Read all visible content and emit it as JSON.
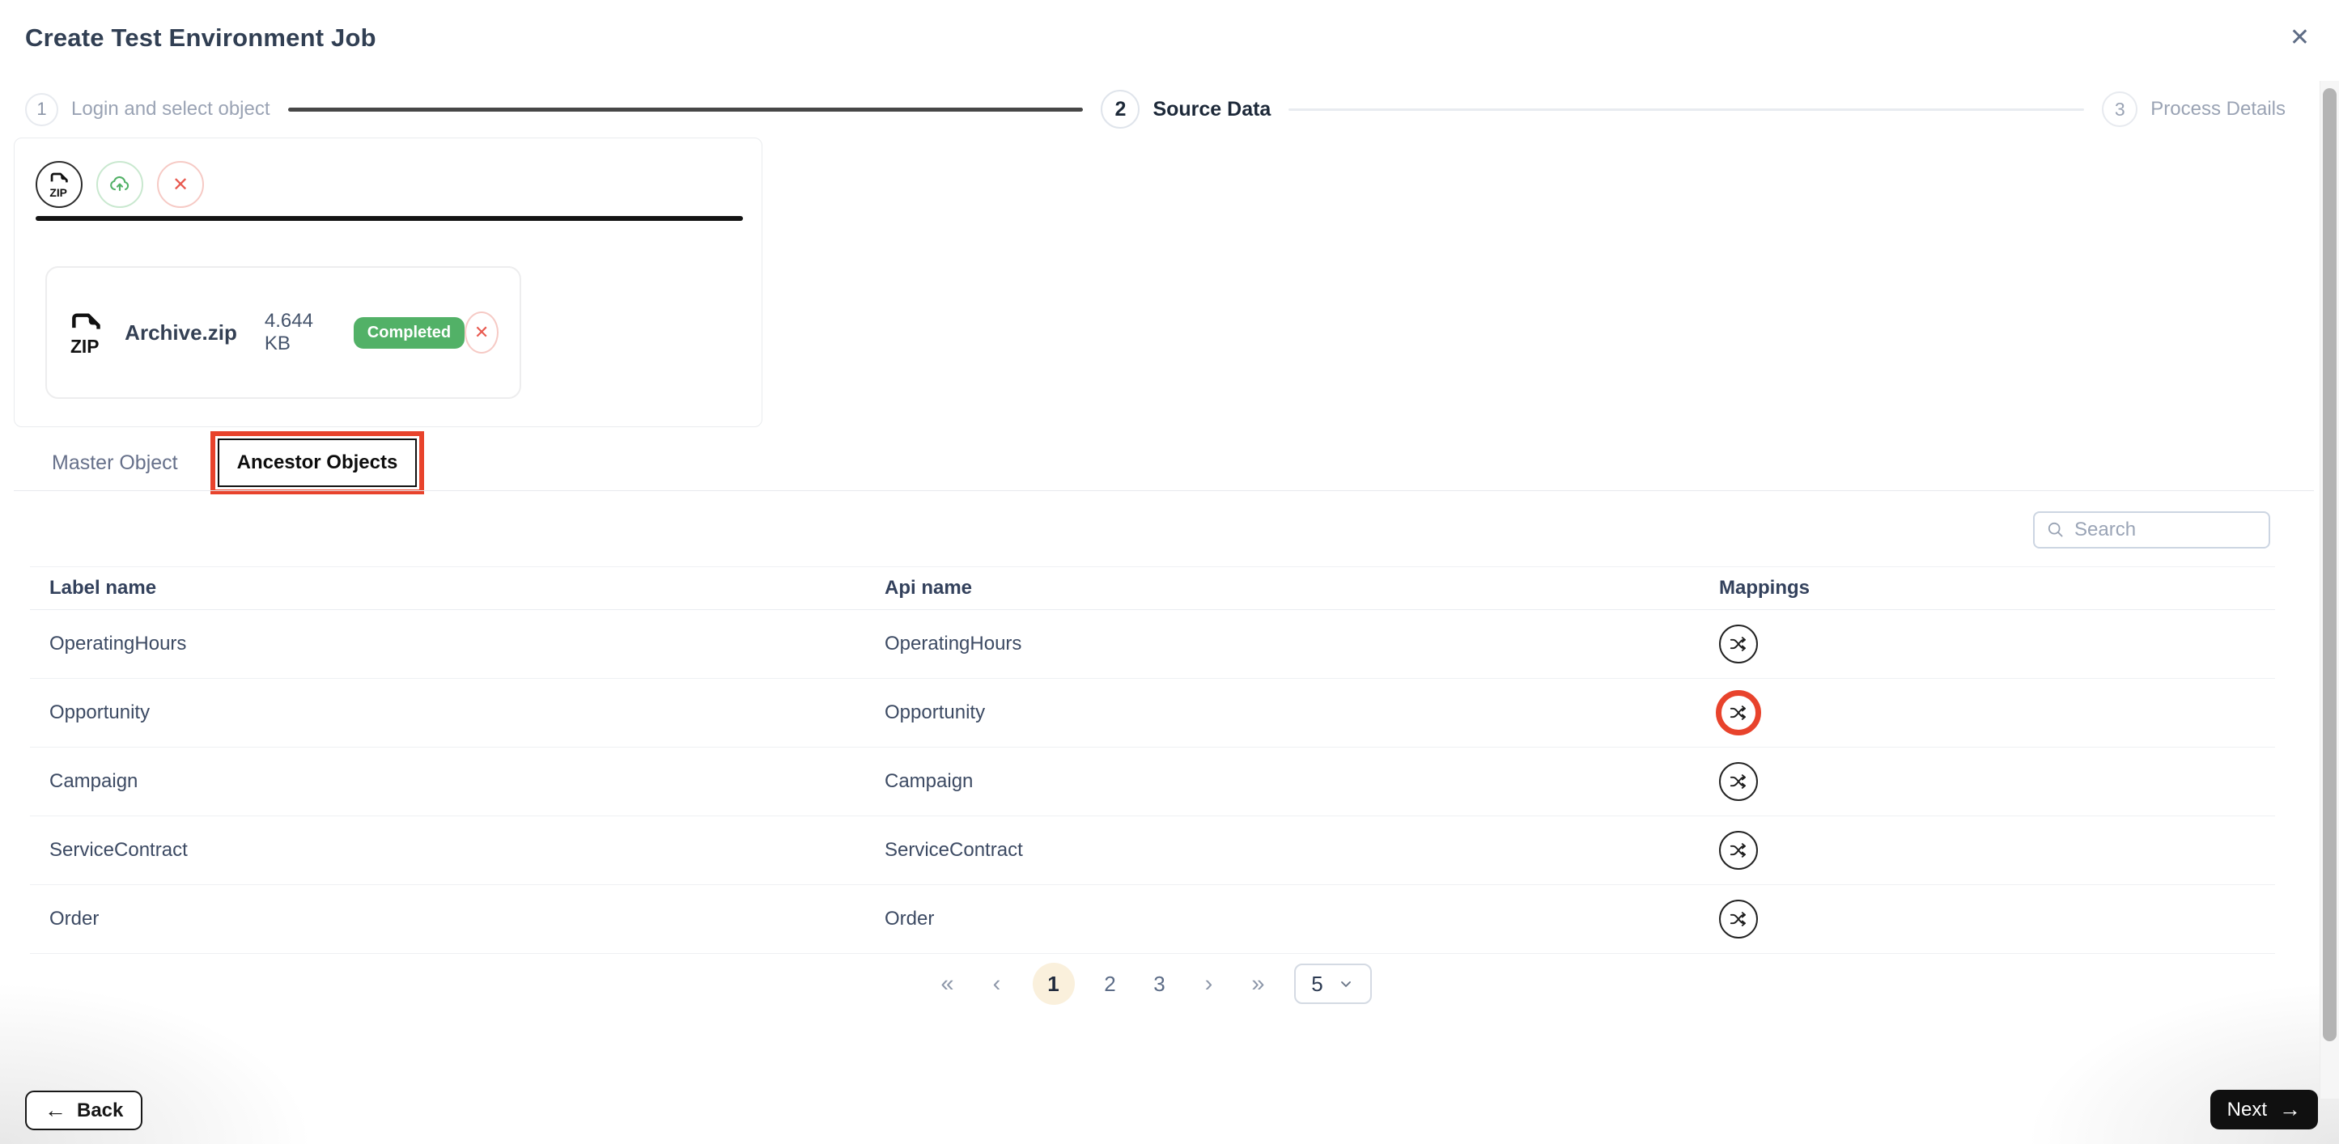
{
  "header": {
    "title": "Create Test Environment Job"
  },
  "icons": {
    "close": "✕",
    "remove_x": "✕",
    "back_arrow": "←",
    "next_arrow": "→",
    "pagination_first": "«",
    "pagination_prev": "‹",
    "pagination_next": "›",
    "pagination_last": "»",
    "zip_label": "ZIP"
  },
  "stepper": {
    "steps": [
      {
        "number": "1",
        "label": "Login and select object",
        "state": "inactive"
      },
      {
        "number": "2",
        "label": "Source Data",
        "state": "active"
      },
      {
        "number": "3",
        "label": "Process Details",
        "state": "upcoming"
      }
    ]
  },
  "upload": {
    "progress_percent": 100,
    "file": {
      "name": "Archive.zip",
      "size": "4.644 KB",
      "status": "Completed",
      "type_label": "ZIP"
    }
  },
  "tabs": [
    {
      "label": "Master Object",
      "active": false
    },
    {
      "label": "Ancestor Objects",
      "active": true,
      "annotated": true
    }
  ],
  "search": {
    "placeholder": "Search",
    "value": ""
  },
  "table": {
    "columns": [
      "Label name",
      "Api name",
      "Mappings"
    ],
    "rows": [
      {
        "label_name": "OperatingHours",
        "api_name": "OperatingHours",
        "highlighted": false
      },
      {
        "label_name": "Opportunity",
        "api_name": "Opportunity",
        "highlighted": true
      },
      {
        "label_name": "Campaign",
        "api_name": "Campaign",
        "highlighted": false
      },
      {
        "label_name": "ServiceContract",
        "api_name": "ServiceContract",
        "highlighted": false
      },
      {
        "label_name": "Order",
        "api_name": "Order",
        "highlighted": false
      }
    ]
  },
  "pagination": {
    "pages": [
      "1",
      "2",
      "3"
    ],
    "active_page": "1",
    "page_size": "5"
  },
  "footer": {
    "back_label": "Back",
    "next_label": "Next"
  },
  "colors": {
    "annotation_red": "#e8432c",
    "success_green": "#52b167",
    "active_page_bg": "#faf0dc",
    "accent_dark": "#101010"
  }
}
